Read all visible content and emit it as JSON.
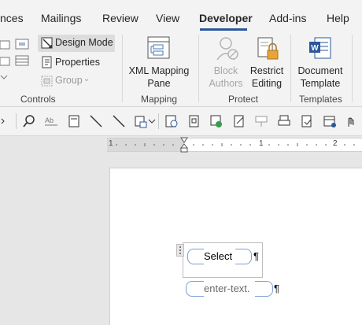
{
  "tabs": [
    {
      "label": "nces"
    },
    {
      "label": "Mailings"
    },
    {
      "label": "Review"
    },
    {
      "label": "View"
    },
    {
      "label": "Developer"
    },
    {
      "label": "Add-ins"
    },
    {
      "label": "Help"
    }
  ],
  "ribbon": {
    "controls": {
      "design_mode": "Design Mode",
      "properties": "Properties",
      "group": "Group",
      "label": "Controls"
    },
    "mapping": {
      "xml_line1": "XML Mapping",
      "xml_line2": "Pane",
      "label": "Mapping"
    },
    "protect": {
      "block_line1": "Block",
      "block_line2": "Authors",
      "restrict_line1": "Restrict",
      "restrict_line2": "Editing",
      "label": "Protect"
    },
    "templates": {
      "doc_line1": "Document",
      "doc_line2": "Template",
      "label": "Templates"
    }
  },
  "ruler": {
    "marks": [
      "1",
      "1",
      "2"
    ]
  },
  "document": {
    "dropdown_value": "Select",
    "text_placeholder": "enter-text.",
    "pilcrow": "¶"
  }
}
